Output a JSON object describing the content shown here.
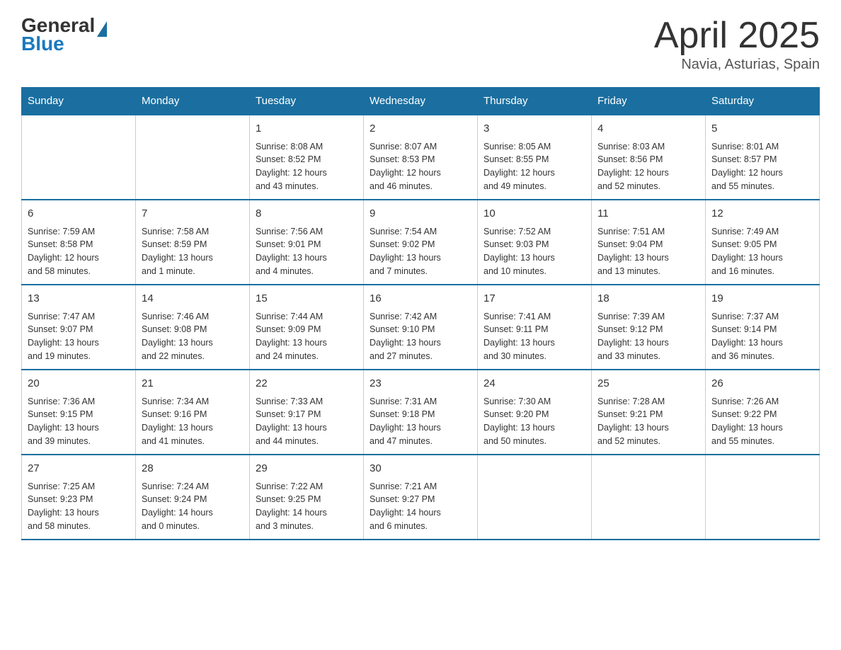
{
  "header": {
    "logo_general": "General",
    "logo_blue": "Blue",
    "month": "April 2025",
    "location": "Navia, Asturias, Spain"
  },
  "days_of_week": [
    "Sunday",
    "Monday",
    "Tuesday",
    "Wednesday",
    "Thursday",
    "Friday",
    "Saturday"
  ],
  "weeks": [
    [
      {
        "day": "",
        "info": ""
      },
      {
        "day": "",
        "info": ""
      },
      {
        "day": "1",
        "info": "Sunrise: 8:08 AM\nSunset: 8:52 PM\nDaylight: 12 hours\nand 43 minutes."
      },
      {
        "day": "2",
        "info": "Sunrise: 8:07 AM\nSunset: 8:53 PM\nDaylight: 12 hours\nand 46 minutes."
      },
      {
        "day": "3",
        "info": "Sunrise: 8:05 AM\nSunset: 8:55 PM\nDaylight: 12 hours\nand 49 minutes."
      },
      {
        "day": "4",
        "info": "Sunrise: 8:03 AM\nSunset: 8:56 PM\nDaylight: 12 hours\nand 52 minutes."
      },
      {
        "day": "5",
        "info": "Sunrise: 8:01 AM\nSunset: 8:57 PM\nDaylight: 12 hours\nand 55 minutes."
      }
    ],
    [
      {
        "day": "6",
        "info": "Sunrise: 7:59 AM\nSunset: 8:58 PM\nDaylight: 12 hours\nand 58 minutes."
      },
      {
        "day": "7",
        "info": "Sunrise: 7:58 AM\nSunset: 8:59 PM\nDaylight: 13 hours\nand 1 minute."
      },
      {
        "day": "8",
        "info": "Sunrise: 7:56 AM\nSunset: 9:01 PM\nDaylight: 13 hours\nand 4 minutes."
      },
      {
        "day": "9",
        "info": "Sunrise: 7:54 AM\nSunset: 9:02 PM\nDaylight: 13 hours\nand 7 minutes."
      },
      {
        "day": "10",
        "info": "Sunrise: 7:52 AM\nSunset: 9:03 PM\nDaylight: 13 hours\nand 10 minutes."
      },
      {
        "day": "11",
        "info": "Sunrise: 7:51 AM\nSunset: 9:04 PM\nDaylight: 13 hours\nand 13 minutes."
      },
      {
        "day": "12",
        "info": "Sunrise: 7:49 AM\nSunset: 9:05 PM\nDaylight: 13 hours\nand 16 minutes."
      }
    ],
    [
      {
        "day": "13",
        "info": "Sunrise: 7:47 AM\nSunset: 9:07 PM\nDaylight: 13 hours\nand 19 minutes."
      },
      {
        "day": "14",
        "info": "Sunrise: 7:46 AM\nSunset: 9:08 PM\nDaylight: 13 hours\nand 22 minutes."
      },
      {
        "day": "15",
        "info": "Sunrise: 7:44 AM\nSunset: 9:09 PM\nDaylight: 13 hours\nand 24 minutes."
      },
      {
        "day": "16",
        "info": "Sunrise: 7:42 AM\nSunset: 9:10 PM\nDaylight: 13 hours\nand 27 minutes."
      },
      {
        "day": "17",
        "info": "Sunrise: 7:41 AM\nSunset: 9:11 PM\nDaylight: 13 hours\nand 30 minutes."
      },
      {
        "day": "18",
        "info": "Sunrise: 7:39 AM\nSunset: 9:12 PM\nDaylight: 13 hours\nand 33 minutes."
      },
      {
        "day": "19",
        "info": "Sunrise: 7:37 AM\nSunset: 9:14 PM\nDaylight: 13 hours\nand 36 minutes."
      }
    ],
    [
      {
        "day": "20",
        "info": "Sunrise: 7:36 AM\nSunset: 9:15 PM\nDaylight: 13 hours\nand 39 minutes."
      },
      {
        "day": "21",
        "info": "Sunrise: 7:34 AM\nSunset: 9:16 PM\nDaylight: 13 hours\nand 41 minutes."
      },
      {
        "day": "22",
        "info": "Sunrise: 7:33 AM\nSunset: 9:17 PM\nDaylight: 13 hours\nand 44 minutes."
      },
      {
        "day": "23",
        "info": "Sunrise: 7:31 AM\nSunset: 9:18 PM\nDaylight: 13 hours\nand 47 minutes."
      },
      {
        "day": "24",
        "info": "Sunrise: 7:30 AM\nSunset: 9:20 PM\nDaylight: 13 hours\nand 50 minutes."
      },
      {
        "day": "25",
        "info": "Sunrise: 7:28 AM\nSunset: 9:21 PM\nDaylight: 13 hours\nand 52 minutes."
      },
      {
        "day": "26",
        "info": "Sunrise: 7:26 AM\nSunset: 9:22 PM\nDaylight: 13 hours\nand 55 minutes."
      }
    ],
    [
      {
        "day": "27",
        "info": "Sunrise: 7:25 AM\nSunset: 9:23 PM\nDaylight: 13 hours\nand 58 minutes."
      },
      {
        "day": "28",
        "info": "Sunrise: 7:24 AM\nSunset: 9:24 PM\nDaylight: 14 hours\nand 0 minutes."
      },
      {
        "day": "29",
        "info": "Sunrise: 7:22 AM\nSunset: 9:25 PM\nDaylight: 14 hours\nand 3 minutes."
      },
      {
        "day": "30",
        "info": "Sunrise: 7:21 AM\nSunset: 9:27 PM\nDaylight: 14 hours\nand 6 minutes."
      },
      {
        "day": "",
        "info": ""
      },
      {
        "day": "",
        "info": ""
      },
      {
        "day": "",
        "info": ""
      }
    ]
  ]
}
